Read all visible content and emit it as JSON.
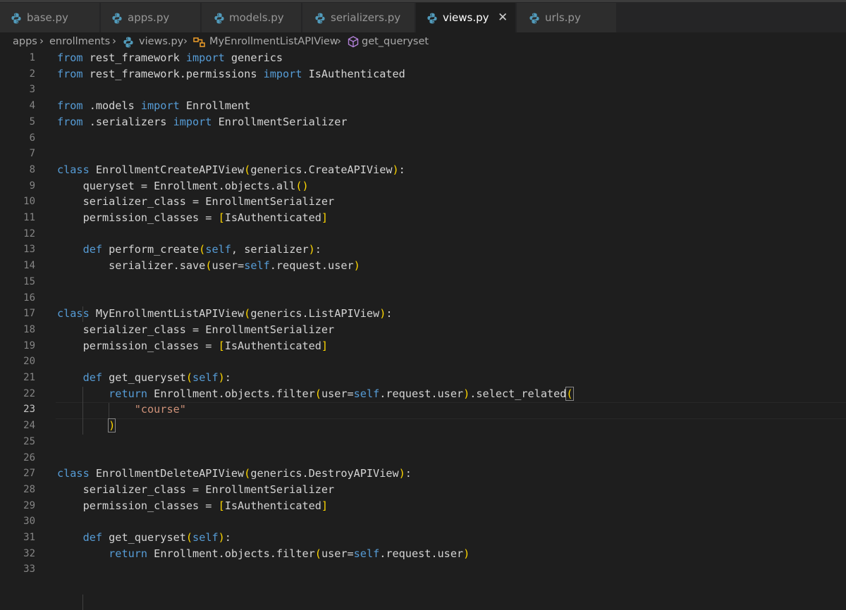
{
  "tabs": [
    {
      "label": "base.py",
      "active": false
    },
    {
      "label": "apps.py",
      "active": false
    },
    {
      "label": "models.py",
      "active": false
    },
    {
      "label": "serializers.py",
      "active": false
    },
    {
      "label": "views.py",
      "active": true
    },
    {
      "label": "urls.py",
      "active": false
    }
  ],
  "close_glyph": "✕",
  "breadcrumb": {
    "folder1": "apps",
    "folder2": "enrollments",
    "file": "views.py",
    "class": "MyEnrollmentListAPIView",
    "method": "get_queryset"
  },
  "editor": {
    "current_line": 23,
    "line_numbers": [
      "1",
      "2",
      "3",
      "4",
      "5",
      "6",
      "7",
      "8",
      "9",
      "10",
      "11",
      "12",
      "13",
      "14",
      "15",
      "16",
      "17",
      "18",
      "19",
      "20",
      "21",
      "22",
      "23",
      "24",
      "25",
      "26",
      "27",
      "28",
      "29",
      "30",
      "31",
      "32",
      "33"
    ],
    "lines": [
      "from rest_framework import generics",
      "from rest_framework.permissions import IsAuthenticated",
      "",
      "from .models import Enrollment",
      "from .serializers import EnrollmentSerializer",
      "",
      "",
      "class EnrollmentCreateAPIView(generics.CreateAPIView):",
      "    queryset = Enrollment.objects.all()",
      "    serializer_class = EnrollmentSerializer",
      "    permission_classes = [IsAuthenticated]",
      "",
      "    def perform_create(self, serializer):",
      "        serializer.save(user=self.request.user)",
      "",
      "",
      "class MyEnrollmentListAPIView(generics.ListAPIView):",
      "    serializer_class = EnrollmentSerializer",
      "    permission_classes = [IsAuthenticated]",
      "",
      "    def get_queryset(self):",
      "        return Enrollment.objects.filter(user=self.request.user).select_related(",
      "            \"course\"",
      "        )",
      "",
      "",
      "class EnrollmentDeleteAPIView(generics.DestroyAPIView):",
      "    serializer_class = EnrollmentSerializer",
      "    permission_classes = [IsAuthenticated]",
      "",
      "    def get_queryset(self):",
      "        return Enrollment.objects.filter(user=self.request.user)",
      ""
    ]
  },
  "colors": {
    "background": "#1e1e1e",
    "keyword": "#569cd6",
    "string": "#ce9178",
    "bracket_level1": "#ffd700",
    "bracket_level2": "#da70d6",
    "python_icon_blue": "#519aba"
  }
}
